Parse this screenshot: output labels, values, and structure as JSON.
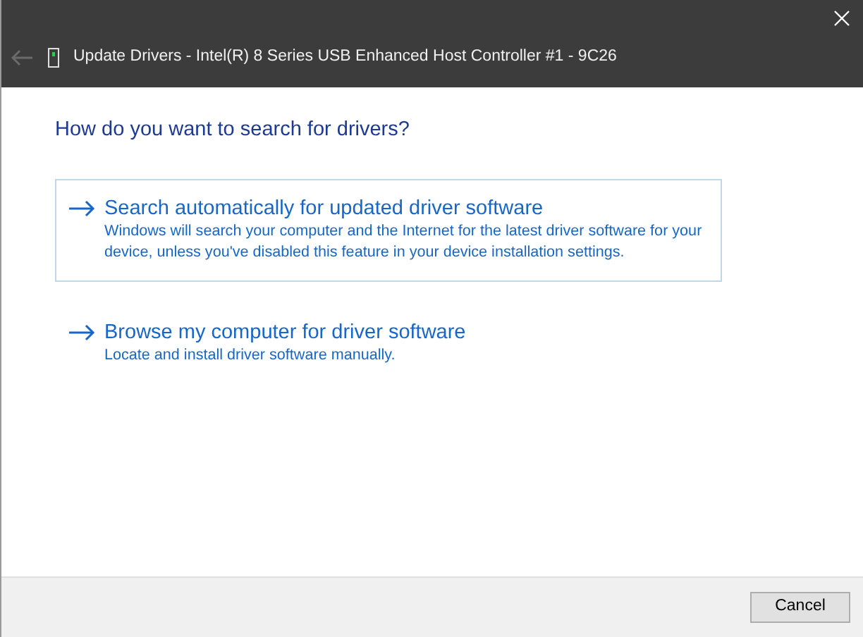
{
  "window": {
    "title": "Update Drivers - Intel(R) 8 Series USB Enhanced Host Controller #1 - 9C26",
    "back_disabled": true
  },
  "heading": "How do you want to search for drivers?",
  "options": [
    {
      "title": "Search automatically for updated driver software",
      "description": "Windows will search your computer and the Internet for the latest driver software for your device, unless you've disabled this feature in your device installation settings.",
      "selected": true
    },
    {
      "title": "Browse my computer for driver software",
      "description": "Locate and install driver software manually.",
      "selected": false
    }
  ],
  "buttons": [
    "Cancel"
  ]
}
